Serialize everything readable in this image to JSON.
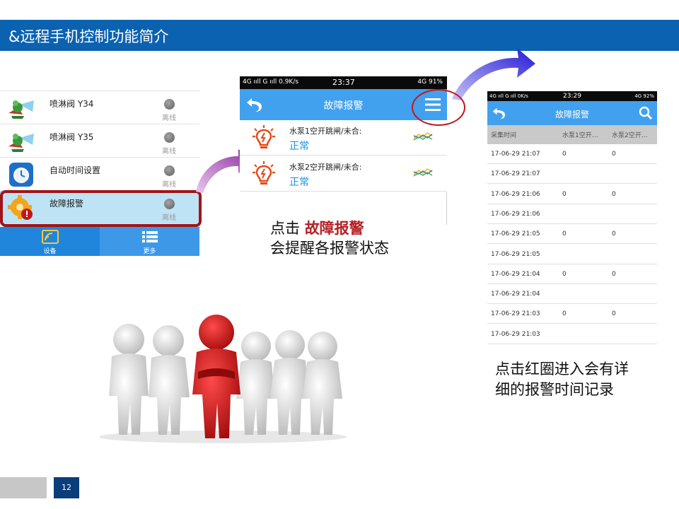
{
  "slide": {
    "title": "&远程手机控制功能简介",
    "page_number": "12"
  },
  "device_list": {
    "items": [
      {
        "name": "喷淋阀 Y34",
        "status": "离线",
        "icon": "sprinkler-icon"
      },
      {
        "name": "喷淋阀 Y35",
        "status": "离线",
        "icon": "sprinkler-icon"
      },
      {
        "name": "自动时间设置",
        "status": "离线",
        "icon": "alarm-clock-icon"
      },
      {
        "name": "故障报警",
        "status": "离线",
        "icon": "gear-warning-icon"
      }
    ],
    "tabs": [
      {
        "label": "设备",
        "icon": "device-icon"
      },
      {
        "label": "更多",
        "icon": "list-icon"
      }
    ]
  },
  "phone_alarm": {
    "status_bar": {
      "left": "4G ııll G ııll 0.9K/s",
      "time": "23:37",
      "right": "4G 91%"
    },
    "header_title": "故障报警",
    "items": [
      {
        "label": "水泵1空开跳闸/未合:",
        "value": "正常"
      },
      {
        "label": "水泵2空开跳闸/未合:",
        "value": "正常"
      }
    ]
  },
  "phone_history": {
    "status_bar": {
      "left": "4G ııll G ııll 0K/s",
      "time": "23:29",
      "right": "4G 92%"
    },
    "header_title": "故障报警",
    "columns": [
      "采集时间",
      "水泵1空开…",
      "水泵2空开…"
    ],
    "rows": [
      [
        "17-06-29 21:07",
        "0",
        "0"
      ],
      [
        "17-06-29 21:07",
        "",
        ""
      ],
      [
        "17-06-29 21:06",
        "0",
        "0"
      ],
      [
        "17-06-29 21:06",
        "",
        ""
      ],
      [
        "17-06-29 21:05",
        "0",
        "0"
      ],
      [
        "17-06-29 21:05",
        "",
        ""
      ],
      [
        "17-06-29 21:04",
        "0",
        "0"
      ],
      [
        "17-06-29 21:04",
        "",
        ""
      ],
      [
        "17-06-29 21:03",
        "0",
        "0"
      ],
      [
        "17-06-29 21:03",
        "",
        ""
      ]
    ]
  },
  "captions": {
    "click_prefix": "点击 ",
    "click_highlight": "故障报警",
    "click_line2": "会提醒各报警状态",
    "detail_line1": "点击红圈进入会有详",
    "detail_line2": "细的报警时间记录"
  },
  "colors": {
    "title_bar": "#0b62b0",
    "app_header": "#41a1ee",
    "highlight_red": "#b51f24",
    "value_blue": "#1c8ee4"
  }
}
